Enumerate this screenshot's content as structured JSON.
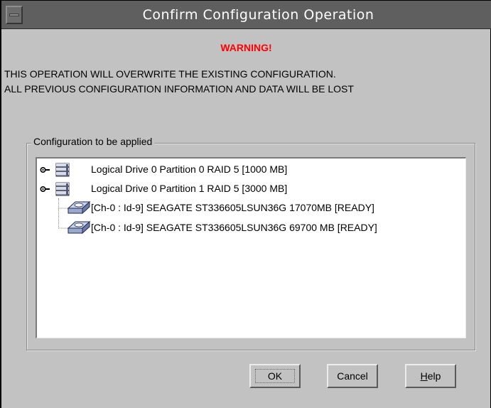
{
  "window": {
    "title": "Confirm Configuration Operation"
  },
  "dialog": {
    "warning": "WARNING!",
    "message_line1": "THIS OPERATION WILL OVERWRITE THE EXISTING CONFIGURATION.",
    "message_line2": "ALL PREVIOUS CONFIGURATION INFORMATION AND DATA WILL BE LOST",
    "group_label": "Configuration to be applied"
  },
  "tree": {
    "items": [
      {
        "label": "Logical Drive 0 Partition 0 RAID 5 [1000 MB]",
        "icon": "database-icon",
        "expander": "expand-handle-icon"
      },
      {
        "label": "Logical Drive 0 Partition 1 RAID 5 [3000 MB]",
        "icon": "database-icon",
        "expander": "expand-handle-icon"
      },
      {
        "label": "[Ch-0 : Id-9] SEAGATE ST336605LSUN36G 17070MB [READY]",
        "icon": "hard-disk-icon"
      },
      {
        "label": "[Ch-0 : Id-9] SEAGATE ST336605LSUN36G 69700 MB [READY]",
        "icon": "hard-disk-icon"
      }
    ]
  },
  "buttons": {
    "ok": "OK",
    "cancel": "Cancel",
    "help_mnemonic": "H",
    "help_rest": "elp"
  },
  "colors": {
    "titlebar": "#5f5f5f",
    "dialog_bg": "#c2c2c2",
    "warning": "#ff0000"
  }
}
